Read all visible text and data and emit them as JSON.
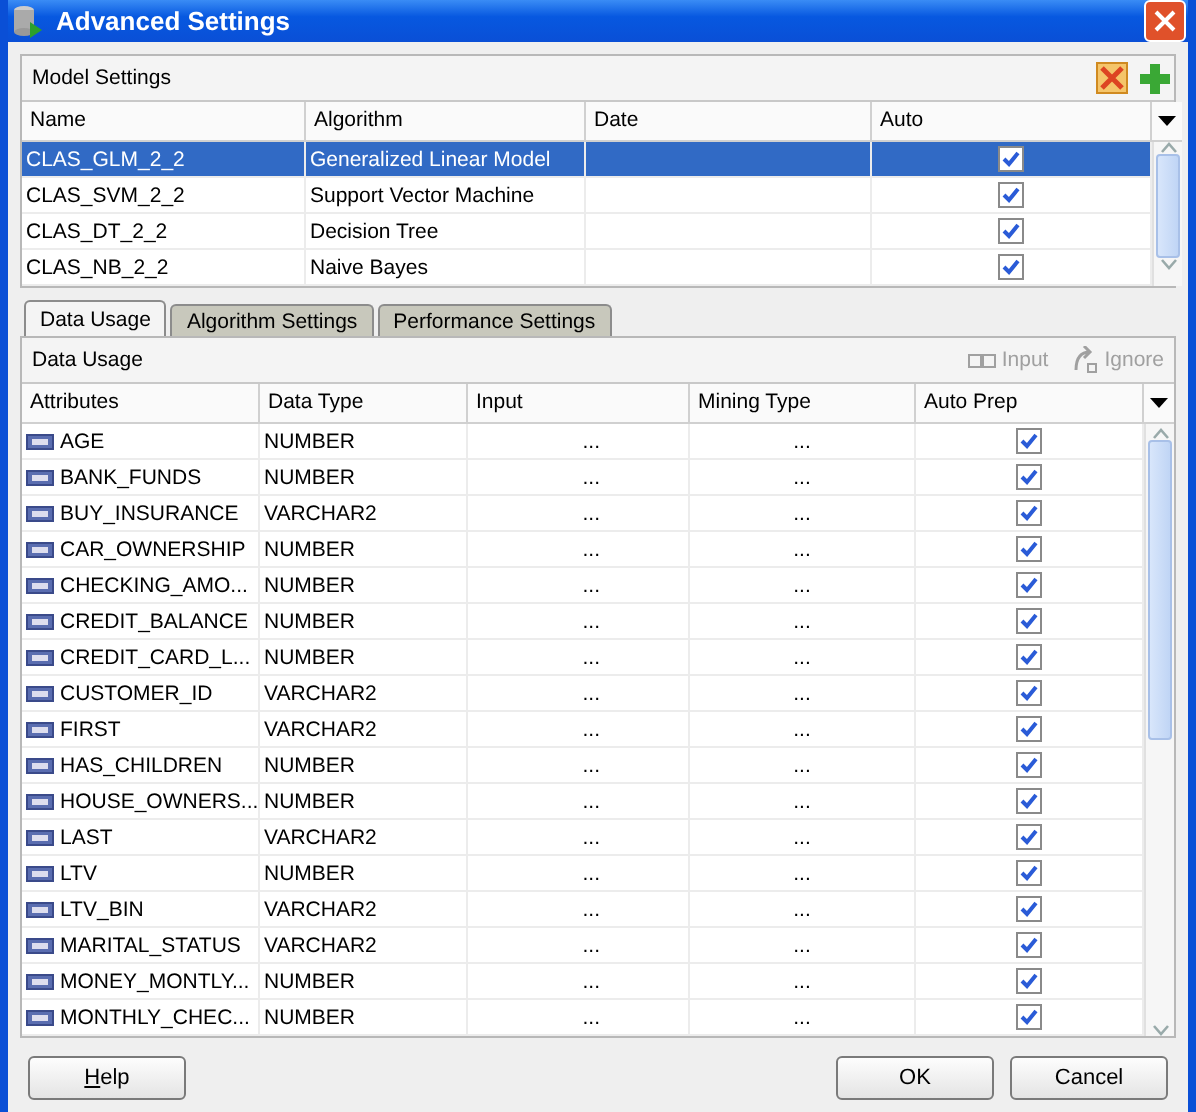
{
  "window": {
    "title": "Advanced Settings"
  },
  "model_settings": {
    "title": "Model Settings",
    "columns": [
      "Name",
      "Algorithm",
      "Date",
      "Auto"
    ],
    "rows": [
      {
        "name": "CLAS_GLM_2_2",
        "algorithm": "Generalized Linear Model",
        "auto": true,
        "selected": true
      },
      {
        "name": "CLAS_SVM_2_2",
        "algorithm": "Support Vector Machine",
        "auto": true,
        "selected": false
      },
      {
        "name": "CLAS_DT_2_2",
        "algorithm": "Decision Tree",
        "auto": true,
        "selected": false
      },
      {
        "name": "CLAS_NB_2_2",
        "algorithm": "Naive Bayes",
        "auto": true,
        "selected": false
      }
    ]
  },
  "tabs": [
    {
      "label": "Data Usage",
      "selected": true
    },
    {
      "label": "Algorithm Settings",
      "selected": false
    },
    {
      "label": "Performance Settings",
      "selected": false
    }
  ],
  "data_usage": {
    "title": "Data Usage",
    "actions": [
      {
        "label": "Input",
        "disabled": true
      },
      {
        "label": "Ignore",
        "disabled": true
      }
    ],
    "columns": [
      "Attributes",
      "Data Type",
      "Input",
      "Mining Type",
      "Auto Prep"
    ],
    "rows": [
      {
        "attribute": "AGE",
        "data_type": "NUMBER",
        "input": "...",
        "mining_type": "...",
        "auto_prep": true
      },
      {
        "attribute": "BANK_FUNDS",
        "data_type": "NUMBER",
        "input": "...",
        "mining_type": "...",
        "auto_prep": true
      },
      {
        "attribute": "BUY_INSURANCE",
        "data_type": "VARCHAR2",
        "input": "...",
        "mining_type": "...",
        "auto_prep": true
      },
      {
        "attribute": "CAR_OWNERSHIP",
        "data_type": "NUMBER",
        "input": "...",
        "mining_type": "...",
        "auto_prep": true
      },
      {
        "attribute": "CHECKING_AMO...",
        "data_type": "NUMBER",
        "input": "...",
        "mining_type": "...",
        "auto_prep": true
      },
      {
        "attribute": "CREDIT_BALANCE",
        "data_type": "NUMBER",
        "input": "...",
        "mining_type": "...",
        "auto_prep": true
      },
      {
        "attribute": "CREDIT_CARD_L...",
        "data_type": "NUMBER",
        "input": "...",
        "mining_type": "...",
        "auto_prep": true
      },
      {
        "attribute": "CUSTOMER_ID",
        "data_type": "VARCHAR2",
        "input": "...",
        "mining_type": "...",
        "auto_prep": true
      },
      {
        "attribute": "FIRST",
        "data_type": "VARCHAR2",
        "input": "...",
        "mining_type": "...",
        "auto_prep": true
      },
      {
        "attribute": "HAS_CHILDREN",
        "data_type": "NUMBER",
        "input": "...",
        "mining_type": "...",
        "auto_prep": true
      },
      {
        "attribute": "HOUSE_OWNERS...",
        "data_type": "NUMBER",
        "input": "...",
        "mining_type": "...",
        "auto_prep": true
      },
      {
        "attribute": "LAST",
        "data_type": "VARCHAR2",
        "input": "...",
        "mining_type": "...",
        "auto_prep": true
      },
      {
        "attribute": "LTV",
        "data_type": "NUMBER",
        "input": "...",
        "mining_type": "...",
        "auto_prep": true
      },
      {
        "attribute": "LTV_BIN",
        "data_type": "VARCHAR2",
        "input": "...",
        "mining_type": "...",
        "auto_prep": true
      },
      {
        "attribute": "MARITAL_STATUS",
        "data_type": "VARCHAR2",
        "input": "...",
        "mining_type": "...",
        "auto_prep": true
      },
      {
        "attribute": "MONEY_MONTLY...",
        "data_type": "NUMBER",
        "input": "...",
        "mining_type": "...",
        "auto_prep": true
      },
      {
        "attribute": "MONTHLY_CHEC...",
        "data_type": "NUMBER",
        "input": "...",
        "mining_type": "...",
        "auto_prep": true
      }
    ]
  },
  "buttons": [
    {
      "label": "Help"
    },
    {
      "label": "OK"
    },
    {
      "label": "Cancel"
    }
  ]
}
